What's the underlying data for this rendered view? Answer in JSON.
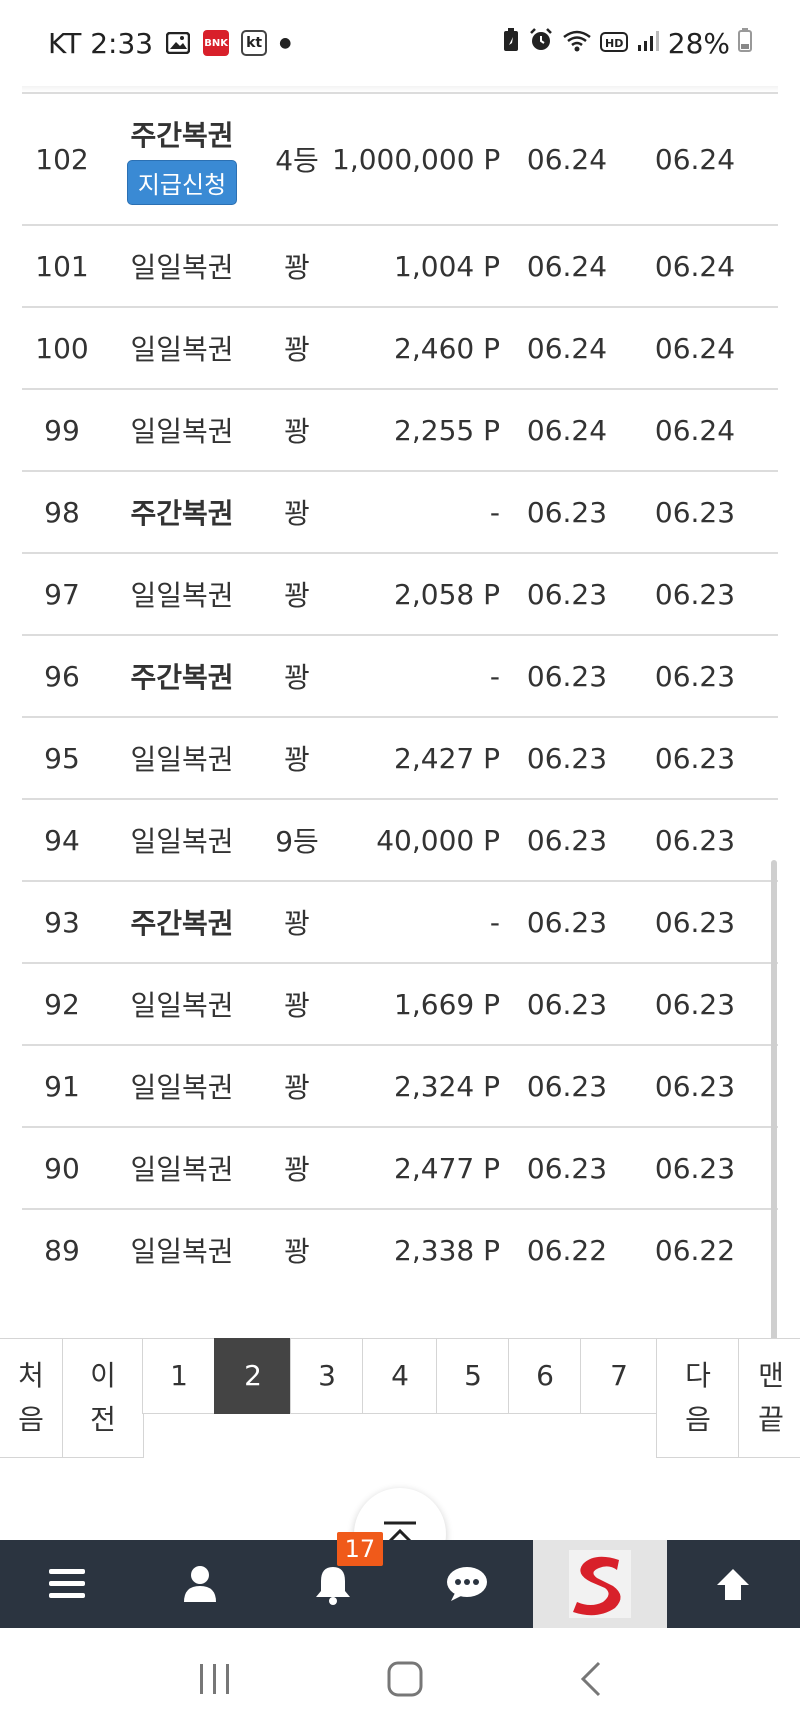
{
  "status_bar": {
    "carrier_time": "KT 2:33",
    "bnk_label": "BNK",
    "kt_label": "kt",
    "battery": "28%"
  },
  "table": {
    "rows": [
      {
        "no": "102",
        "type": "주간복권",
        "type_bold": true,
        "claim_label": "지급신청",
        "rank": "4등",
        "amount": "1,000,000 P",
        "date1": "06.24",
        "date2": "06.24"
      },
      {
        "no": "101",
        "type": "일일복권",
        "type_bold": false,
        "rank": "꽝",
        "amount": "1,004 P",
        "date1": "06.24",
        "date2": "06.24"
      },
      {
        "no": "100",
        "type": "일일복권",
        "type_bold": false,
        "rank": "꽝",
        "amount": "2,460 P",
        "date1": "06.24",
        "date2": "06.24"
      },
      {
        "no": "99",
        "type": "일일복권",
        "type_bold": false,
        "rank": "꽝",
        "amount": "2,255 P",
        "date1": "06.24",
        "date2": "06.24"
      },
      {
        "no": "98",
        "type": "주간복권",
        "type_bold": true,
        "rank": "꽝",
        "amount": "-",
        "date1": "06.23",
        "date2": "06.23"
      },
      {
        "no": "97",
        "type": "일일복권",
        "type_bold": false,
        "rank": "꽝",
        "amount": "2,058 P",
        "date1": "06.23",
        "date2": "06.23"
      },
      {
        "no": "96",
        "type": "주간복권",
        "type_bold": true,
        "rank": "꽝",
        "amount": "-",
        "date1": "06.23",
        "date2": "06.23"
      },
      {
        "no": "95",
        "type": "일일복권",
        "type_bold": false,
        "rank": "꽝",
        "amount": "2,427 P",
        "date1": "06.23",
        "date2": "06.23"
      },
      {
        "no": "94",
        "type": "일일복권",
        "type_bold": false,
        "rank": "9등",
        "amount": "40,000 P",
        "date1": "06.23",
        "date2": "06.23"
      },
      {
        "no": "93",
        "type": "주간복권",
        "type_bold": true,
        "rank": "꽝",
        "amount": "-",
        "date1": "06.23",
        "date2": "06.23"
      },
      {
        "no": "92",
        "type": "일일복권",
        "type_bold": false,
        "rank": "꽝",
        "amount": "1,669 P",
        "date1": "06.23",
        "date2": "06.23"
      },
      {
        "no": "91",
        "type": "일일복권",
        "type_bold": false,
        "rank": "꽝",
        "amount": "2,324 P",
        "date1": "06.23",
        "date2": "06.23"
      },
      {
        "no": "90",
        "type": "일일복권",
        "type_bold": false,
        "rank": "꽝",
        "amount": "2,477 P",
        "date1": "06.23",
        "date2": "06.23"
      },
      {
        "no": "89",
        "type": "일일복권",
        "type_bold": false,
        "rank": "꽝",
        "amount": "2,338 P",
        "date1": "06.22",
        "date2": "06.22"
      }
    ]
  },
  "pagination": {
    "first": "처음",
    "prev": "이전",
    "pages": [
      "1",
      "2",
      "3",
      "4",
      "5",
      "6",
      "7"
    ],
    "current": "2",
    "next": "다음",
    "last": "맨끝"
  },
  "bottom_nav": {
    "notification_count": "17",
    "colors": {
      "bar": "#2b3440",
      "badge": "#f05a1a",
      "brand": "#d8202a"
    }
  },
  "colors": {
    "claim_button": "#3a8ad4",
    "active_page": "#444444"
  }
}
